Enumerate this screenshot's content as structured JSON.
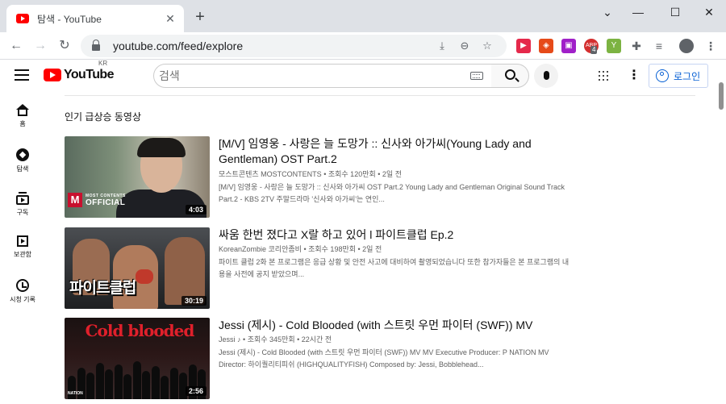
{
  "browser": {
    "tab_title": "탐색 - YouTube",
    "tab_close": "✕",
    "new_tab": "+",
    "url": "youtube.com/feed/explore",
    "window_controls": {
      "minimize": "—",
      "maximize": "☐",
      "close": "✕",
      "dropdown": "⌄"
    },
    "nav": {
      "back": "←",
      "forward": "→",
      "reload": "↻"
    },
    "omnibox_icons": {
      "install": "⤓",
      "zoom": "⊖",
      "bookmark": "☆"
    },
    "extensions": [
      {
        "name": "extension-red",
        "label": "▶",
        "color": "#e5294b"
      },
      {
        "name": "extension-tag",
        "label": "◈",
        "color": "#e64a19"
      },
      {
        "name": "extension-purple",
        "label": "▣",
        "color": "#a020c8"
      },
      {
        "name": "extension-abp",
        "label": "ABP",
        "color": "#d32f2f",
        "badge": "4"
      },
      {
        "name": "extension-y",
        "label": "Y",
        "color": "#7cb342"
      },
      {
        "name": "extension-puzzle",
        "label": "✚",
        "color": "#5f6368"
      },
      {
        "name": "extension-playlist",
        "label": "≡",
        "color": "#5f6368"
      }
    ]
  },
  "header": {
    "logo_text": "YouTube",
    "country_code": "KR",
    "search_placeholder": "검색",
    "more_dots": "⋮",
    "signin_label": "로그인"
  },
  "sidebar": {
    "items": [
      {
        "label": "홈",
        "icon": "home-icon"
      },
      {
        "label": "탐색",
        "icon": "explore-icon"
      },
      {
        "label": "구독",
        "icon": "subscriptions-icon"
      },
      {
        "label": "보관함",
        "icon": "library-icon"
      },
      {
        "label": "시청 기록",
        "icon": "history-icon"
      }
    ]
  },
  "main": {
    "section_title": "인기 급상승 동영상",
    "videos": [
      {
        "title": "[M/V] 임영웅 - 사랑은 늘 도망가 :: 신사와 아가씨(Young Lady and Gentleman) OST Part.2",
        "channel": "모스트콘텐츠 MOSTCONTENTS",
        "views": "조회수 120만회",
        "age": "2일 전",
        "description": "[M/V] 임영웅 - 사랑은 늘 도망가 :: 신사와 아가씨 OST Part.2 Young Lady and Gentleman Original Sound Track Part.2 - KBS 2TV 주말드라마 '신사와 아가씨'는 연인...",
        "duration": "4:03",
        "thumb_logo_small": "MOST CONTENTS",
        "thumb_logo_big": "OFFICIAL",
        "thumb_logo_mark": "M"
      },
      {
        "title": "싸움 한번 졌다고 X랄 하고 있어 l 파이트클럽 Ep.2",
        "channel": "KoreanZombie 코리안좀비",
        "views": "조회수 198만회",
        "age": "2일 전",
        "description": "파이트 클럽 2화 본 프로그램은 응급 상황 및 안전 사고에 대비하여 촬영되었습니다 또한 참가자들은 본 프로그램의 내용을 사전에 공지 받았으며...",
        "duration": "30:19",
        "thumb_text": "파이트클럽"
      },
      {
        "title": "Jessi (제시) - Cold Blooded (with 스트릿 우먼 파이터 (SWF)) MV",
        "channel": "Jessi",
        "music_note": "♪",
        "views": "조회수 345만회",
        "age": "22시간 전",
        "description": "Jessi (제시) - Cold Blooded (with 스트릿 우먼 파이터 (SWF)) MV MV Executive Producer: P NATION MV Director: 하이퀄리티피쉬 (HIGHQUALITYFISH) Composed by: Jessi, Bobblehead...",
        "duration": "2:56",
        "thumb_text": "Cold blooded",
        "thumb_tag": "NATION"
      }
    ]
  },
  "colors": {
    "brand_red": "#ff0000",
    "link_blue": "#065fd4",
    "meta_gray": "#606060"
  }
}
